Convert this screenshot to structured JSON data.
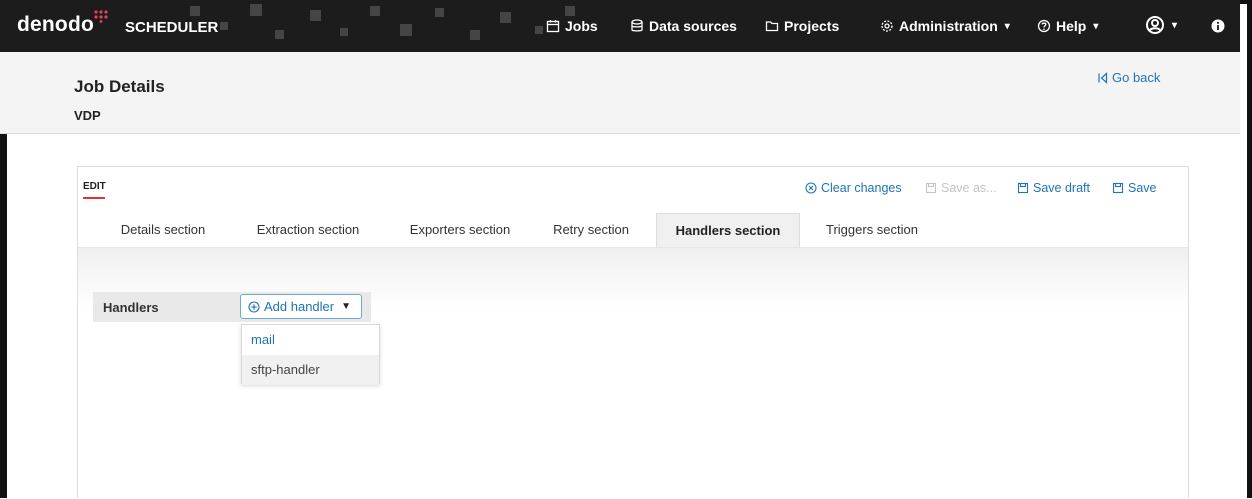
{
  "nav": {
    "brand": "denodo",
    "product": "SCHEDULER",
    "items": [
      {
        "label": "Jobs",
        "icon": "calendar-icon"
      },
      {
        "label": "Data sources",
        "icon": "database-icon"
      },
      {
        "label": "Projects",
        "icon": "folder-icon"
      },
      {
        "label": "Administration",
        "icon": "gear-icon"
      },
      {
        "label": "Help",
        "icon": "help-icon"
      }
    ],
    "user_icon": "user-icon",
    "info_icon": "info-icon"
  },
  "header": {
    "title": "Job Details",
    "subtitle": "VDP",
    "go_back": "Go back"
  },
  "panel": {
    "mode_label": "EDIT",
    "actions": {
      "clear_changes": "Clear changes",
      "save_as": "Save as...",
      "save_draft": "Save draft",
      "save": "Save"
    },
    "tabs": [
      {
        "label": "Details section"
      },
      {
        "label": "Extraction section"
      },
      {
        "label": "Exporters section"
      },
      {
        "label": "Retry section"
      },
      {
        "label": "Handlers section"
      },
      {
        "label": "Triggers section"
      }
    ],
    "active_tab": "Handlers section",
    "handlers": {
      "label": "Handlers",
      "add_button": "Add handler",
      "options": [
        "mail",
        "sftp-handler"
      ]
    }
  },
  "colors": {
    "nav_bg": "#1c1c1c",
    "link": "#1f73b7",
    "accent_red": "#d33333",
    "brand_dots": "#e8405a"
  }
}
